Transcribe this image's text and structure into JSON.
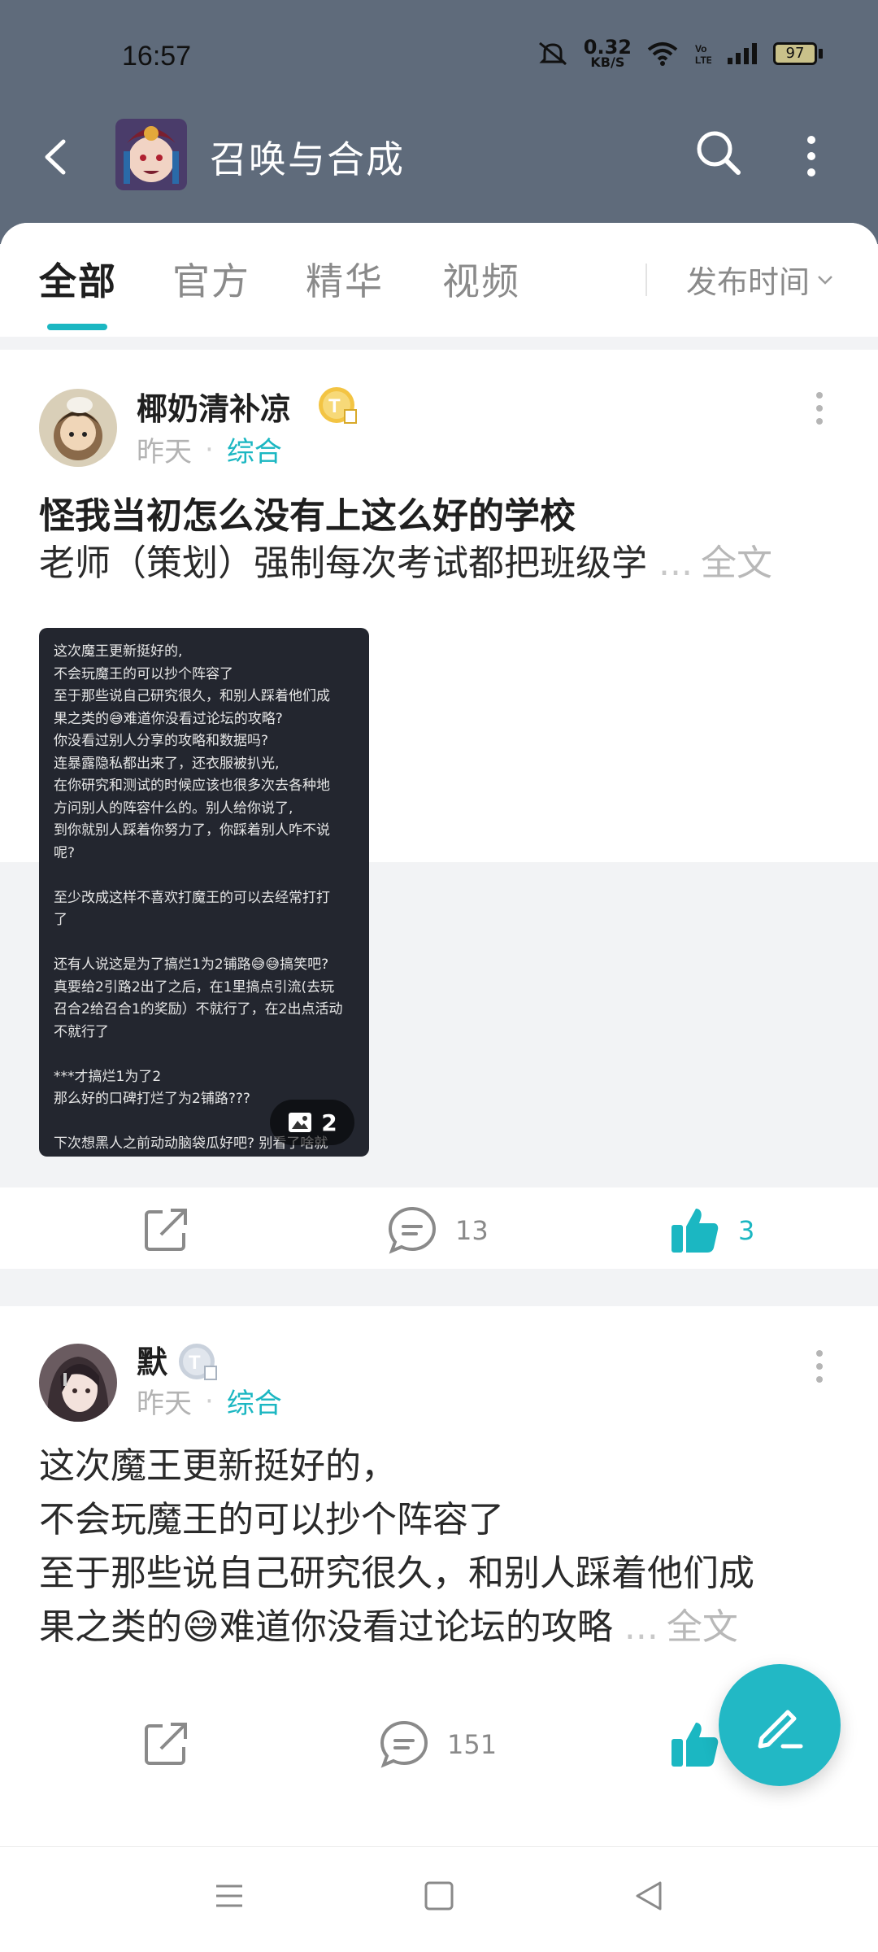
{
  "status_bar": {
    "time": "16:57",
    "speed_value": "0.32",
    "speed_unit": "KB/S",
    "volte": "VoLTE",
    "battery": "97"
  },
  "header": {
    "title": "召唤与合成"
  },
  "tabs": {
    "items": [
      "全部",
      "官方",
      "精华",
      "视频"
    ],
    "active": "全部",
    "sort_label": "发布时间"
  },
  "posts": [
    {
      "author": "椰奶清补凉",
      "date": "昨天",
      "category": "综合",
      "title": "怪我当初怎么没有上这么好的学校",
      "body": "老师（策划）强制每次考试都把班级学",
      "more": "...",
      "fulltext": "全文",
      "image_count": "2",
      "image_text_lines": [
        "这次魔王更新挺好的,",
        "不会玩魔王的可以抄个阵容了",
        "至于那些说自己研究很久，和别人踩着他们成",
        "果之类的😅难道你没看过论坛的攻略?",
        "你没看过别人分享的攻略和数据吗?",
        "连暴露隐私都出来了，还衣服被扒光,",
        "在你研究和测试的时候应该也很多次去各种地",
        "方问别人的阵容什么的。别人给你说了,",
        "到你就别人踩着你努力了，你踩着别人咋不说",
        "呢?",
        "",
        "至少改成这样不喜欢打魔王的可以去经常打打",
        "了",
        "",
        "还有人说这是为了搞烂1为2铺路😅😅搞笑吧?",
        "真要给2引路2出了之后，在1里搞点引流(去玩",
        "召合2给召合1的奖励）不就行了，在2出点活动",
        "不就行了",
        "",
        "***才搞烂1为了2",
        "那么好的口碑打烂了为2铺路???",
        "",
        "下次想黑人之前动动脑袋瓜好吧? 别看了啥就"
      ],
      "comments": "13",
      "likes": "3"
    },
    {
      "author": "默",
      "date": "昨天",
      "category": "综合",
      "body_lines": [
        "这次魔王更新挺好的，",
        "不会玩魔王的可以抄个阵容了",
        "至于那些说自己研究很久，和别人踩着他们成",
        "果之类的😅难道你没看过论坛的攻略"
      ],
      "more": "...",
      "fulltext": "全文",
      "comments": "151"
    }
  ],
  "colors": {
    "accent": "#1bb7c2",
    "header_bg": "#5f6b7b",
    "badge_gold": "#f3c443",
    "badge_silver": "#c9d1dc"
  }
}
